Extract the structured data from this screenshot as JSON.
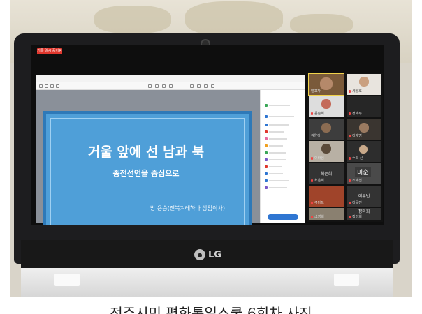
{
  "recording_badge": "기록 일시 중지됨",
  "slide": {
    "title": "거울 앞에 선 남과 북",
    "subtitle": "종전선언을 중심으로",
    "author": "방 용승(전북겨레하나 상임이사)"
  },
  "gallery": {
    "tiles": [
      {
        "name": "발표자"
      },
      {
        "name": "세월호"
      },
      {
        "name": "윤순희"
      },
      {
        "name": "정재주"
      },
      {
        "name": "김연아"
      },
      {
        "name": "이재명"
      },
      {
        "name": "이바심"
      },
      {
        "name": "수희 신"
      },
      {
        "name": "김교인"
      },
      {
        "name": "최은희"
      },
      {
        "name": "미순"
      },
      {
        "name": "최은희"
      },
      {
        "name": "소재선"
      },
      {
        "name": "이유빈"
      },
      {
        "name": "주마트"
      },
      {
        "name": "이유진"
      },
      {
        "name": "정미희"
      },
      {
        "name": "소영희"
      },
      {
        "name": "정미희"
      }
    ]
  },
  "brand": {
    "logo_text": "LG"
  },
  "caption": "전주시민 평화통일스쿨 6회차 사진"
}
